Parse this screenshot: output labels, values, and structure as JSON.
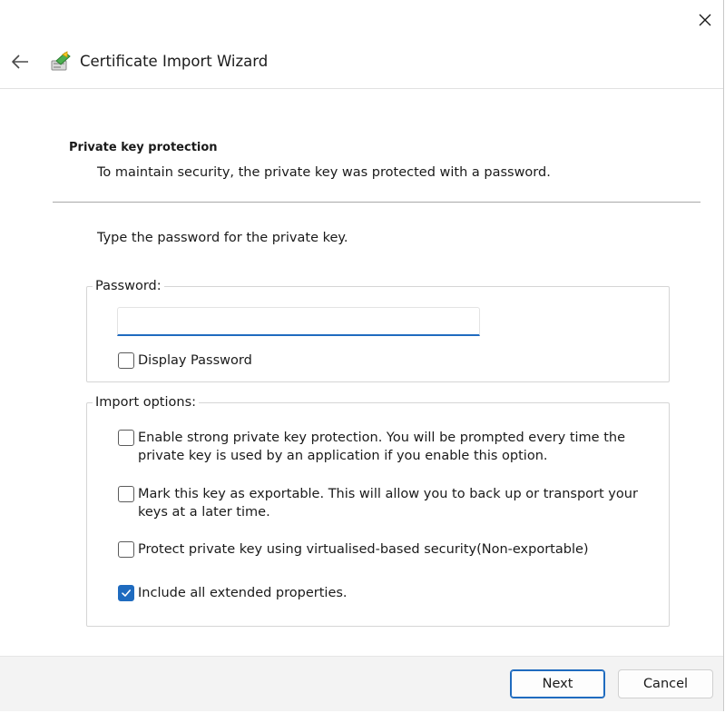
{
  "window": {
    "title": "Certificate Import Wizard",
    "icons": {
      "close": "close-icon",
      "back": "back-arrow-icon",
      "wizard": "certificate-wizard-icon"
    }
  },
  "section": {
    "heading": "Private key protection",
    "description": "To maintain security, the private key was protected with a password."
  },
  "instruction": "Type the password for the private key.",
  "password_group": {
    "legend": "Password:",
    "input_value": "",
    "display_password": {
      "label": "Display Password",
      "checked": false
    }
  },
  "import_options": {
    "legend": "Import options:",
    "options": [
      {
        "label_line1": "Enable strong private key protection. You will be prompted every time the",
        "label_line2": "private key is used by an application if you enable this option.",
        "checked": false
      },
      {
        "label_line1": "Mark this key as exportable. This will allow you to back up or transport your",
        "label_line2": "keys at a later time.",
        "checked": false
      },
      {
        "label_line1": "Protect private key using virtualised-based security(Non-exportable)",
        "label_line2": "",
        "checked": false
      },
      {
        "label_line1": "Include all extended properties.",
        "label_line2": "",
        "checked": true
      }
    ]
  },
  "buttons": {
    "next": "Next",
    "cancel": "Cancel"
  },
  "colors": {
    "accent": "#1f6bbf",
    "footer_bg": "#f3f3f3"
  }
}
